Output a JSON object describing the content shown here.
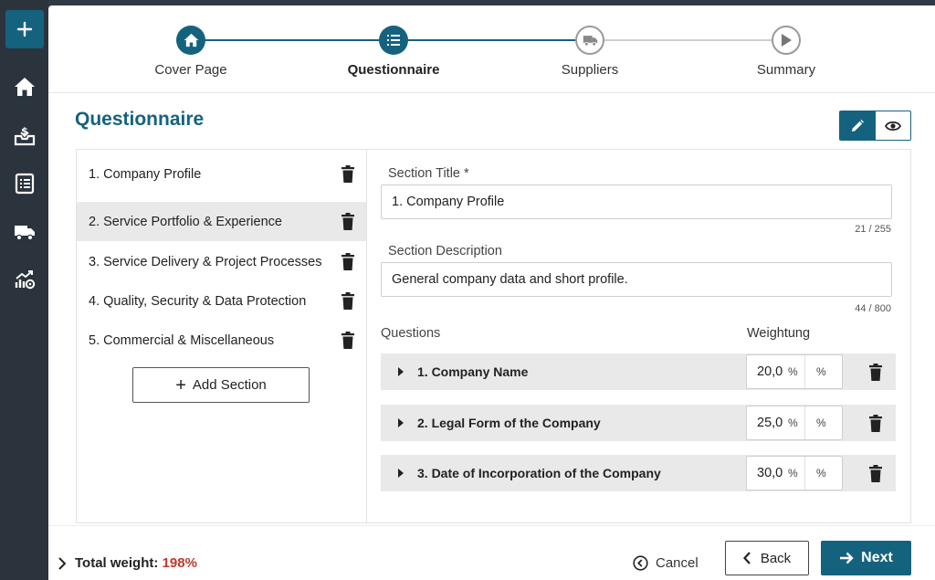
{
  "sidebar": {
    "items": [
      {
        "icon": "plus-icon"
      },
      {
        "icon": "home-icon"
      },
      {
        "icon": "inbox-dollar-icon"
      },
      {
        "icon": "list-icon"
      },
      {
        "icon": "truck-icon"
      },
      {
        "icon": "chart-settings-icon"
      }
    ]
  },
  "stepper": {
    "steps": [
      {
        "label": "Cover Page",
        "icon": "home-icon",
        "state": "done"
      },
      {
        "label": "Questionnaire",
        "icon": "list-icon",
        "state": "active"
      },
      {
        "label": "Suppliers",
        "icon": "truck-icon",
        "state": "todo"
      },
      {
        "label": "Summary",
        "icon": "play-icon",
        "state": "todo"
      }
    ]
  },
  "page": {
    "title": "Questionnaire"
  },
  "view_toggle": {
    "edit_icon": "pencil-icon",
    "preview_icon": "eye-icon"
  },
  "sections": [
    {
      "label": "1. Company Profile"
    },
    {
      "label": "2. Service Portfolio & Experience"
    },
    {
      "label": "3. Service Delivery & Project Processes"
    },
    {
      "label": "4. Quality, Security & Data Protection"
    },
    {
      "label": "5. Commercial & Miscellaneous"
    }
  ],
  "add_section_label": "Add Section",
  "form": {
    "title_label": "Section Title *",
    "title_value": "1. Company Profile",
    "title_count": "21 / 255",
    "desc_label": "Section Description",
    "desc_value": "General company data and short profile.",
    "desc_count": "44 / 800",
    "questions_label": "Questions",
    "weighting_label": "Weightung"
  },
  "questions": [
    {
      "title": "1. Company Name",
      "weight": "20,0",
      "unit": "%"
    },
    {
      "title": "2. Legal Form of the Company",
      "weight": "25,0",
      "unit": "%"
    },
    {
      "title": "3. Date of Incorporation of the Company",
      "weight": "30,0",
      "unit": "%"
    }
  ],
  "footer": {
    "total_label": "Total weight:",
    "total_value": "198%",
    "cancel_label": "Cancel",
    "back_label": "Back",
    "next_label": "Next"
  },
  "colors": {
    "accent": "#15627f",
    "warning": "#c0392b",
    "sidebar": "#2b343d"
  }
}
